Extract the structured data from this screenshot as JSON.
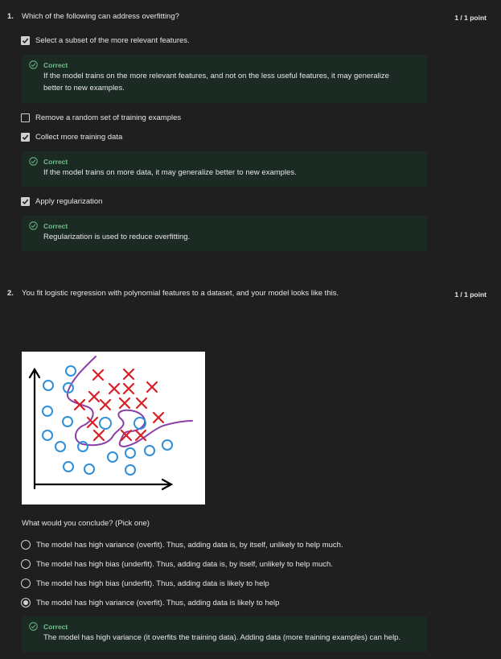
{
  "q1": {
    "number": "1.",
    "text": "Which of the following can address overfitting?",
    "points": "1 / 1 point",
    "options": [
      {
        "label": "Select a subset of the more relevant features.",
        "checked": true
      },
      {
        "label": "Remove a random set of training examples",
        "checked": false
      },
      {
        "label": "Collect more training data",
        "checked": true
      },
      {
        "label": "Apply regularization",
        "checked": true
      }
    ],
    "feedback": [
      {
        "title": "Correct",
        "line1": "If the model trains on the more relevant features, and not on the less useful features, it may generalize",
        "line2": "better to new examples."
      },
      {
        "title": "Correct",
        "line1": "If the model trains on more data, it may generalize better to new examples."
      },
      {
        "title": "Correct",
        "line1": "Regularization is used to reduce overfitting."
      }
    ]
  },
  "q2": {
    "number": "2.",
    "text": "You fit logistic regression with polynomial features to a dataset, and your model looks like this.",
    "points": "1 / 1 point",
    "prompt": "What would you conclude? (Pick one)",
    "options": [
      {
        "label": "The model has high variance (overfit). Thus, adding data is, by itself, unlikely to help much.",
        "selected": false
      },
      {
        "label": "The model has high bias (underfit). Thus, adding data is, by itself, unlikely to help much.",
        "selected": false
      },
      {
        "label": "The model has high bias (underfit). Thus, adding data is likely to help",
        "selected": false
      },
      {
        "label": "The model has high variance (overfit). Thus, adding data is likely to help",
        "selected": true
      }
    ],
    "feedback": {
      "title": "Correct",
      "line1": "The model has high variance (it overfits the training data). Adding data (more training examples) can help."
    }
  },
  "colors": {
    "background": "#1f1f1f",
    "feedback_bg": "#1c2a24",
    "correct_green": "#6dc38a",
    "plot_o": "#2f8fd8",
    "plot_x": "#d81f26",
    "plot_curve": "#8a3fa8"
  }
}
